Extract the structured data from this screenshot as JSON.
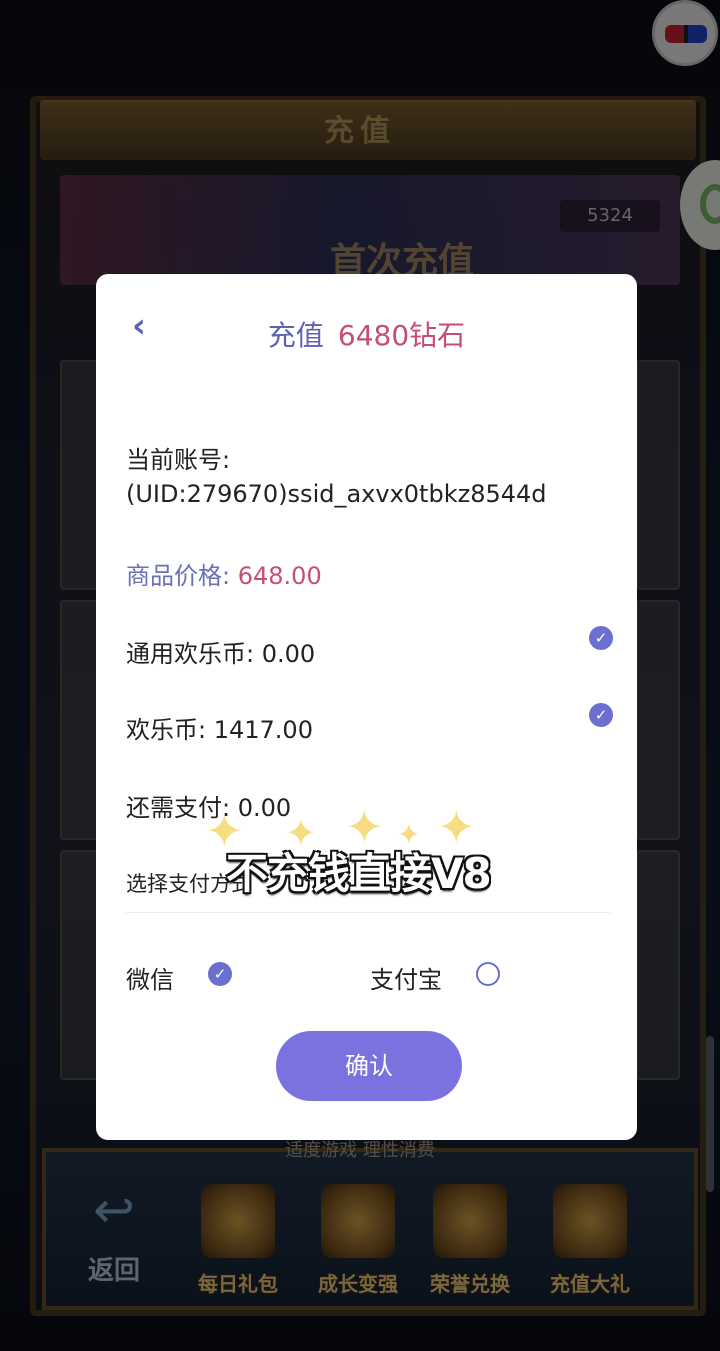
{
  "background": {
    "frame_title": "充值",
    "diamond_count": "5324",
    "banner_text": "首次充值",
    "bottom_hint": "适度游戏 理性消费",
    "back_label": "返回",
    "nav_items": [
      {
        "label": "每日礼包",
        "icon": "gift-icon"
      },
      {
        "label": "成长变强",
        "icon": "fist-icon"
      },
      {
        "label": "荣誉兑换",
        "icon": "medal-icon"
      },
      {
        "label": "充值大礼",
        "icon": "treasure-icon"
      }
    ]
  },
  "modal": {
    "back_icon": "chevron-left-icon",
    "title_prefix": "充值",
    "title_product": "6480钻石",
    "account_label": "当前账号:",
    "account_value": "(UID:279670)ssid_axvx0tbkz8544d",
    "price_label": "商品价格:",
    "price_value": "648.00",
    "general_coin": "通用欢乐币: 0.00",
    "coin": "欢乐币: 1417.00",
    "remaining": "还需支付: 0.00",
    "choose_method": "选择支付方式",
    "wechat": "微信",
    "alipay": "支付宝",
    "confirm": "确认",
    "general_coin_checked": true,
    "coin_checked": true,
    "selected_method": "wechat"
  },
  "caption": "不充钱直接V8",
  "colors": {
    "accent": "#7b72e0",
    "title_purple": "#5d62b3",
    "highlight_pink": "#c54d76"
  }
}
